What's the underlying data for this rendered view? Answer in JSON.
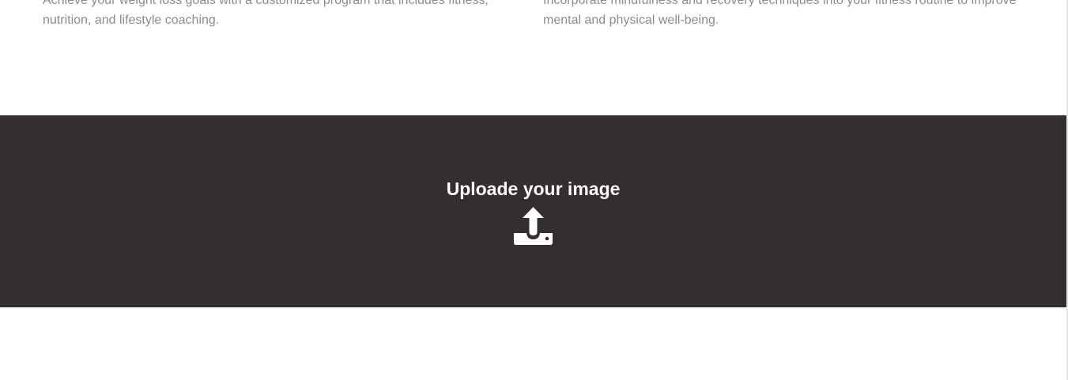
{
  "features": {
    "left_text": "Achieve your weight loss goals with a customized program that includes fitness, nutrition, and lifestyle coaching.",
    "right_text": "Incorporate mindfulness and recovery techniques into your fitness routine to improve mental and physical well-being."
  },
  "upload": {
    "title": "Uploade your image",
    "icon": "upload-tray-icon"
  },
  "colors": {
    "upload_background": "#342e2e",
    "feature_text": "#8c8c8c",
    "upload_text": "#ffffff"
  }
}
